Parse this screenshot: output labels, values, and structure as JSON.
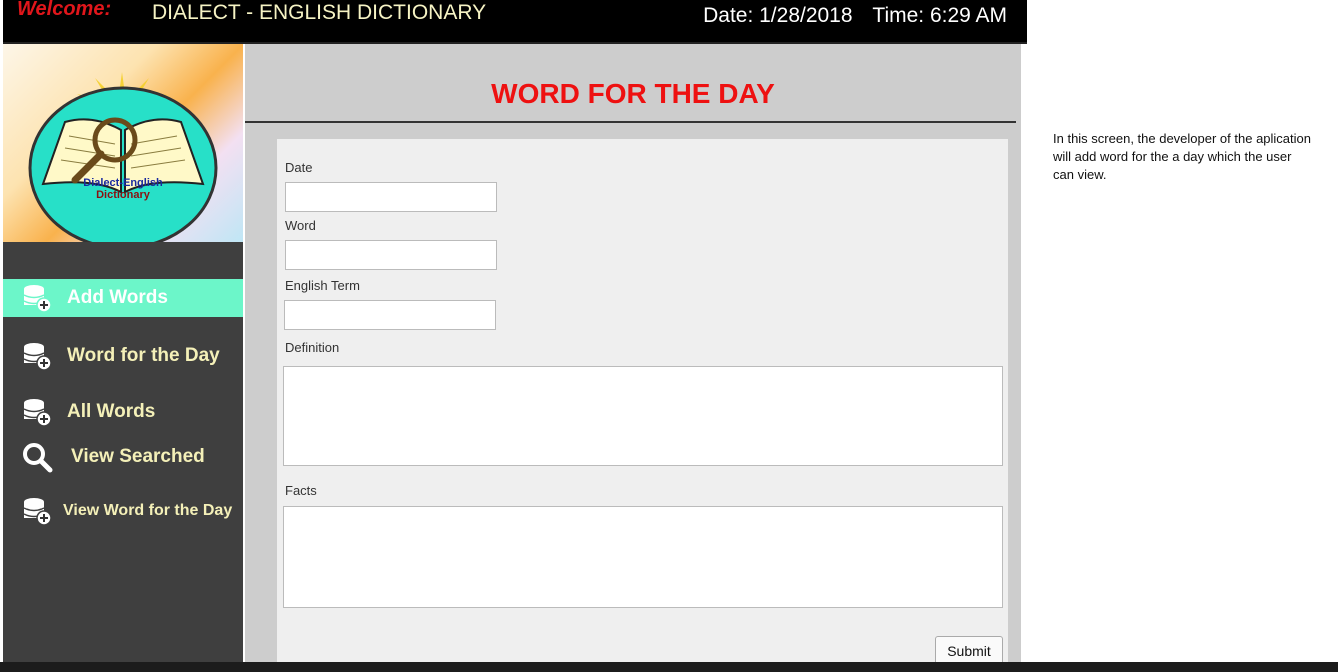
{
  "header": {
    "welcome": "Welcome:",
    "title": "DIALECT - ENGLISH DICTIONARY",
    "date": "Date: 1/28/2018",
    "time": "Time: 6:29 AM"
  },
  "logo": {
    "line1": "Dialect-English",
    "line2": "Dictionary"
  },
  "sidebar": {
    "items": [
      {
        "label": "Add Words",
        "icon": "database-add-icon"
      },
      {
        "label": "Word for the Day",
        "icon": "database-add-icon"
      },
      {
        "label": "All Words",
        "icon": "database-add-icon"
      },
      {
        "label": "View Searched",
        "icon": "search-icon"
      },
      {
        "label": "View Word for the Day",
        "icon": "database-add-icon"
      }
    ]
  },
  "main": {
    "title": "WORD FOR THE DAY",
    "form": {
      "date_label": "Date",
      "word_label": "Word",
      "english_label": "English Term",
      "definition_label": "Definition",
      "facts_label": "Facts",
      "submit_label": "Submit"
    }
  },
  "note": "In this screen, the developer of the aplication will add word for the a day which the user can view.",
  "colors": {
    "accent": "#6cf6c9",
    "title_red": "#ee1111",
    "sidebar_bg": "#3f3f3f"
  }
}
